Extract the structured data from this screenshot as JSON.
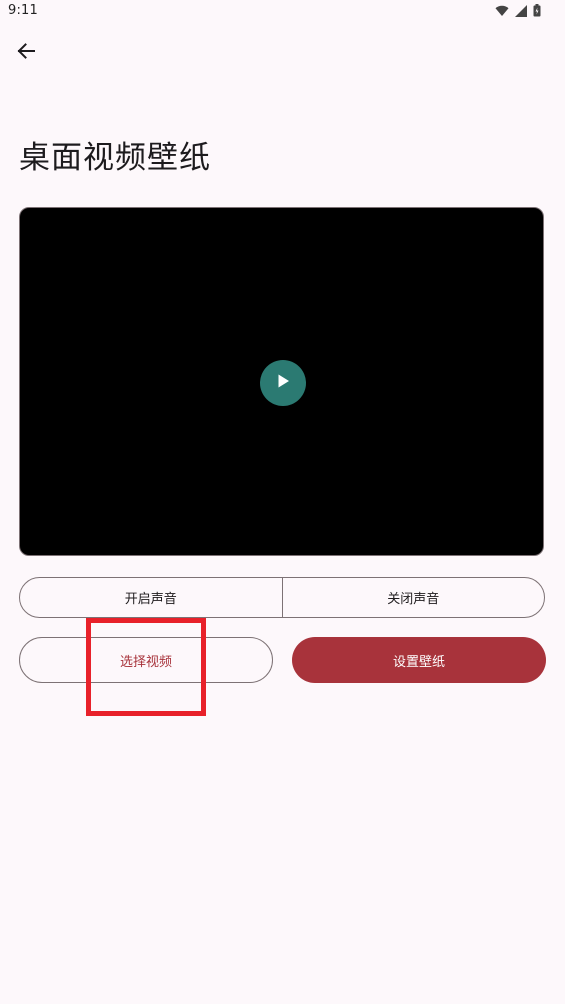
{
  "status_bar": {
    "time": "9:11",
    "icons": [
      "wifi-icon",
      "signal-icon",
      "battery-icon"
    ]
  },
  "header": {
    "back_icon": "arrow-back-icon"
  },
  "main": {
    "title": "桌面视频壁纸",
    "video": {
      "play_icon": "play-icon",
      "play_button_color": "#2b7a72"
    },
    "sound_toggle": {
      "options": [
        "开启声音",
        "关闭声音"
      ]
    },
    "actions": {
      "select_video_label": "选择视频",
      "set_wallpaper_label": "设置壁纸"
    }
  },
  "colors": {
    "accent": "#a8333b",
    "background": "#fdf8fb",
    "highlight": "#e8212a",
    "outline": "#7d7275"
  }
}
